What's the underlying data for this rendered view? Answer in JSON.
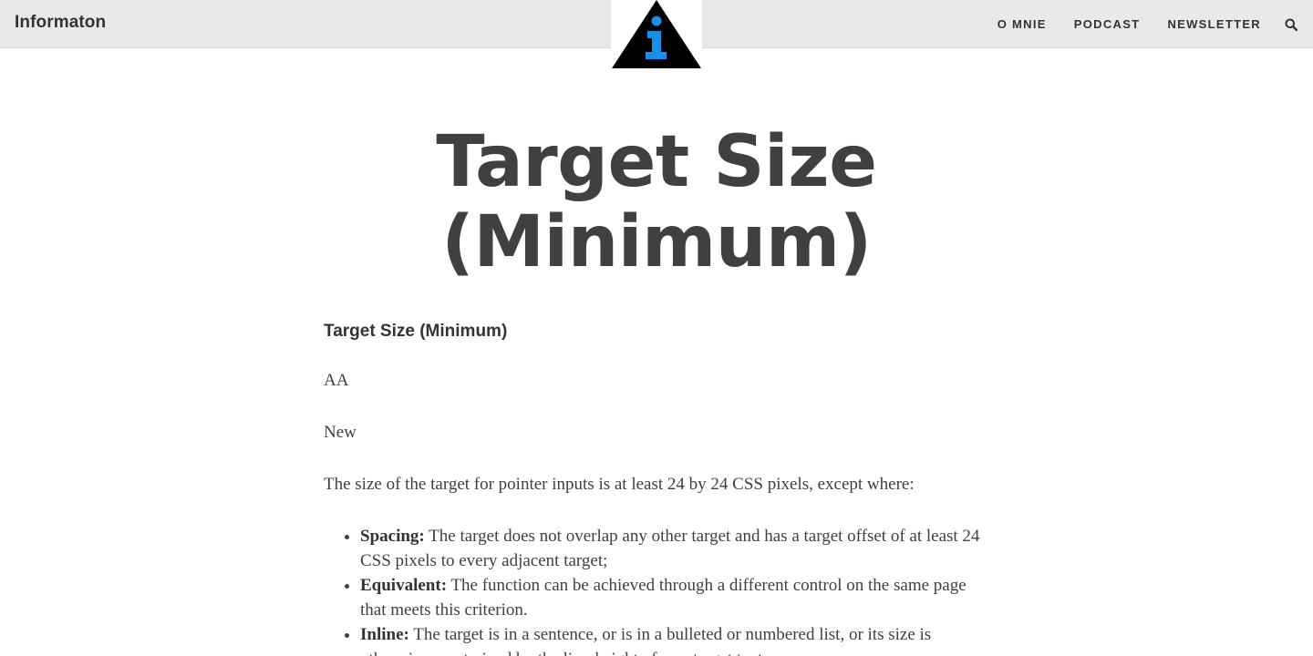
{
  "header": {
    "site_title": "Informaton",
    "logo_icon": "info-triangle-icon",
    "logo_colors": {
      "triangle": "#000000",
      "letter": "#1a8fe8"
    },
    "nav": [
      {
        "label": "O MNIE"
      },
      {
        "label": "PODCAST"
      },
      {
        "label": "NEWSLETTER"
      }
    ],
    "search_icon": "search-icon"
  },
  "article": {
    "title_line1": "Target Size",
    "title_line2": "(Minimum)",
    "subheading": "Target Size (Minimum)",
    "level": "AA",
    "status": "New",
    "intro": "The size of the target for pointer inputs is at least 24 by 24 CSS pixels, except where:",
    "exceptions": [
      {
        "term": "Spacing:",
        "text": " The target does not overlap any other target and has a target offset of at least 24 CSS pixels to every adjacent target;"
      },
      {
        "term": "Equivalent:",
        "text": " The function can be achieved through a different control on the same page that meets this criterion."
      },
      {
        "term": "Inline:",
        "text": " The target is in a sentence, or is in a bulleted or numbered list, or its size is otherwise constrained by the line-height of non-target text;"
      }
    ]
  }
}
